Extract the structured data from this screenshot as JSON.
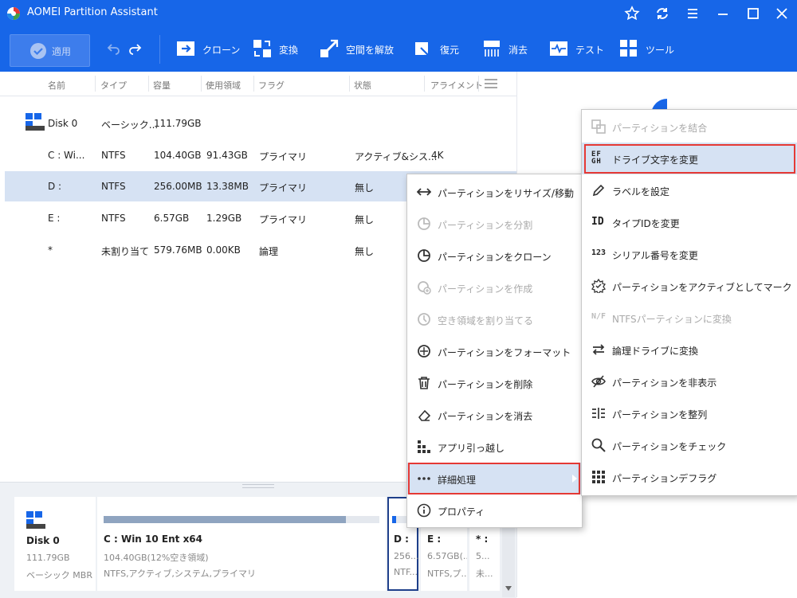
{
  "app": {
    "title": "AOMEI Partition Assistant"
  },
  "toolbar": {
    "apply": "適用",
    "items": [
      {
        "label": "クローン",
        "icon": "clone-icon"
      },
      {
        "label": "変換",
        "icon": "convert-icon"
      },
      {
        "label": "空間を解放",
        "icon": "free-space-icon"
      },
      {
        "label": "復元",
        "icon": "recover-icon"
      },
      {
        "label": "消去",
        "icon": "wipe-icon"
      },
      {
        "label": "テスト",
        "icon": "test-icon"
      },
      {
        "label": "ツール",
        "icon": "tools-icon"
      }
    ]
  },
  "table": {
    "columns": [
      "名前",
      "タイプ",
      "容量",
      "使用領域",
      "フラグ",
      "状態",
      "アライメント"
    ],
    "rows": [
      {
        "name": "Disk 0",
        "type": "ベーシック...",
        "capacity": "111.79GB",
        "used": "",
        "flag": "",
        "status": "",
        "align": ""
      },
      {
        "name": "C : Wi...",
        "type": "NTFS",
        "capacity": "104.40GB",
        "used": "91.43GB",
        "flag": "プライマリ",
        "status": "アクティブ&シス...",
        "align": "4K"
      },
      {
        "name": "D :",
        "type": "NTFS",
        "capacity": "256.00MB",
        "used": "13.38MB",
        "flag": "プライマリ",
        "status": "無し",
        "align": ""
      },
      {
        "name": "E :",
        "type": "NTFS",
        "capacity": "6.57GB",
        "used": "1.29GB",
        "flag": "プライマリ",
        "status": "無し",
        "align": ""
      },
      {
        "name": "*",
        "type": "未割り当て",
        "capacity": "579.76MB",
        "used": "0.00KB",
        "flag": "論理",
        "status": "無し",
        "align": ""
      }
    ]
  },
  "disk_map": {
    "disk": {
      "name": "Disk 0",
      "size": "111.79GB",
      "type": "ベーシック MBR"
    },
    "partitions": [
      {
        "title": "C : Win 10 Ent x64",
        "line1": "104.40GB(12%空き領域)",
        "line2": "NTFS,アクティブ,システム,プライマリ",
        "used_fraction": 0.88
      },
      {
        "title": "D :",
        "line1": "256...",
        "line2": "NTF...",
        "used_fraction": 0.05
      },
      {
        "title": "E :",
        "line1": "6.57GB(...",
        "line2": "NTFS,プ...",
        "used_fraction": 0.2
      },
      {
        "title": "* :",
        "line1": "5...",
        "line2": "未..."
      }
    ]
  },
  "context_menu": {
    "items": [
      {
        "label": "パーティションをリサイズ/移動",
        "icon": "resize-icon",
        "enabled": true
      },
      {
        "label": "パーティションを分割",
        "icon": "split-icon",
        "enabled": false
      },
      {
        "label": "パーティションをクローン",
        "icon": "clone-partition-icon",
        "enabled": true
      },
      {
        "label": "パーティションを作成",
        "icon": "create-icon",
        "enabled": false
      },
      {
        "label": "空き領域を割り当てる",
        "icon": "allocate-icon",
        "enabled": false
      },
      {
        "label": "パーティションをフォーマット",
        "icon": "format-icon",
        "enabled": true
      },
      {
        "label": "パーティションを削除",
        "icon": "delete-icon",
        "enabled": true
      },
      {
        "label": "パーティションを消去",
        "icon": "erase-icon",
        "enabled": true
      },
      {
        "label": "アプリ引っ越し",
        "icon": "app-mover-icon",
        "enabled": true
      },
      {
        "label": "詳細処理",
        "icon": "more-icon",
        "enabled": true,
        "submenu": true
      },
      {
        "label": "プロパティ",
        "icon": "info-icon",
        "enabled": true
      }
    ]
  },
  "submenu": {
    "items": [
      {
        "label": "パーティションを結合",
        "icon": "merge-icon",
        "enabled": false
      },
      {
        "label": "ドライブ文字を変更",
        "icon": "drive-letter-icon",
        "enabled": true,
        "glyph": "EF GH"
      },
      {
        "label": "ラベルを設定",
        "icon": "pencil-icon",
        "enabled": true
      },
      {
        "label": "タイプIDを変更",
        "icon": "type-id-icon",
        "enabled": true,
        "glyph": "ID"
      },
      {
        "label": "シリアル番号を変更",
        "icon": "serial-icon",
        "enabled": true,
        "glyph": "123"
      },
      {
        "label": "パーティションをアクティブとしてマーク",
        "icon": "activate-icon",
        "enabled": true
      },
      {
        "label": "NTFSパーティションに変換",
        "icon": "ntfs-convert-icon",
        "enabled": false,
        "glyph": "N/F"
      },
      {
        "label": "論理ドライブに変換",
        "icon": "swap-icon",
        "enabled": true
      },
      {
        "label": "パーティションを非表示",
        "icon": "hide-icon",
        "enabled": true
      },
      {
        "label": "パーティションを整列",
        "icon": "align-icon",
        "enabled": true
      },
      {
        "label": "パーティションをチェック",
        "icon": "check-icon",
        "enabled": true
      },
      {
        "label": "パーティションデフラグ",
        "icon": "defrag-icon",
        "enabled": true
      }
    ]
  },
  "colors": {
    "brand": "#1766e8",
    "selection": "#d6e2f3",
    "highlight_box": "#e53935",
    "partition_bar": "#8fa4c0",
    "selected_bar": "#1766e8"
  }
}
